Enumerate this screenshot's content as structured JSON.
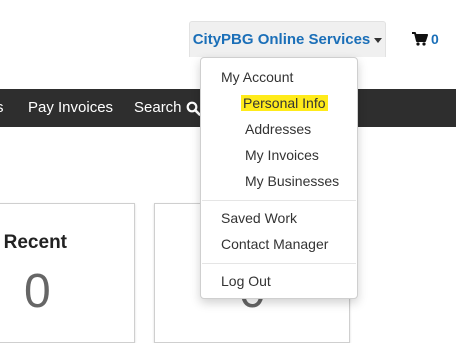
{
  "header": {
    "services_label": "CityPBG Online Services",
    "cart_count": "0",
    "cart_icon": "shopping-cart-icon"
  },
  "navbar": {
    "partial_item": "s",
    "pay_invoices": "Pay Invoices",
    "search": "Search",
    "search_icon": "search-icon"
  },
  "cards": [
    {
      "title": "Recent",
      "value": "0"
    },
    {
      "title": "",
      "value": "0"
    }
  ],
  "dropdown": {
    "section_header": "My Account",
    "account_items": [
      "Personal Info",
      "Addresses",
      "My Invoices",
      "My Businesses"
    ],
    "highlighted_item": "Personal Info",
    "saved_work": "Saved Work",
    "contact_manager": "Contact Manager",
    "log_out": "Log Out"
  },
  "colors": {
    "link_blue": "#1b6fb8",
    "navbar_bg": "#2e2e2e",
    "highlight_yellow": "#ffeb1a"
  }
}
